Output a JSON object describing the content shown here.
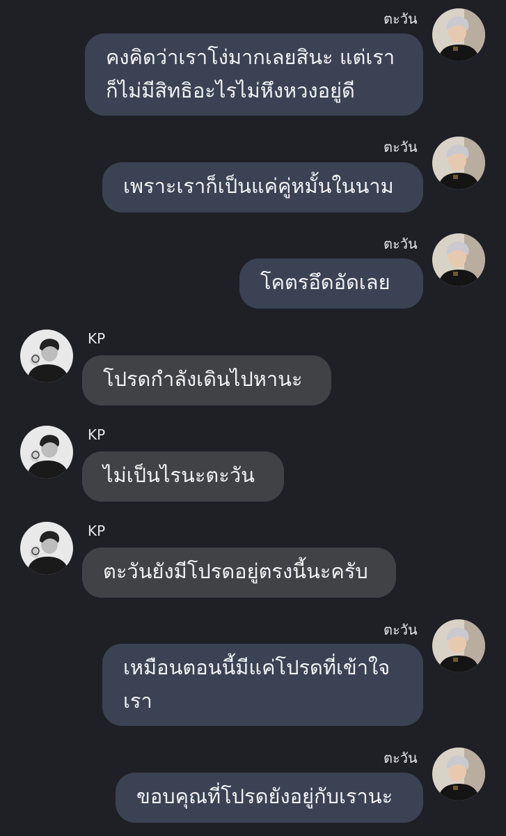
{
  "messages": [
    {
      "side": "me",
      "sender": "ตะวัน",
      "text": "คงคิดว่าเราโง่มากเลยสินะ แต่เรา\nก็ไม่มีสิทธิอะไรไม่หึงหวงอยู่ดี"
    },
    {
      "side": "me",
      "sender": "ตะวัน",
      "text": "เพราะเราก็เป็นแค่คู่หมั้นในนาม"
    },
    {
      "side": "me",
      "sender": "ตะวัน",
      "text": "โคตรอึดอัดเลย"
    },
    {
      "side": "other",
      "sender": "KP",
      "text": "โปรดกำลังเดินไปหานะ"
    },
    {
      "side": "other",
      "sender": "KP",
      "text": "ไม่เป็นไรนะตะวัน"
    },
    {
      "side": "other",
      "sender": "KP",
      "text": "ตะวันยังมีโปรดอยู่ตรงนี้นะครับ"
    },
    {
      "side": "me",
      "sender": "ตะวัน",
      "text": "เหมือนตอนนี้มีแค่โปรดที่เข้าใจ\nเรา"
    },
    {
      "side": "me",
      "sender": "ตะวัน",
      "text": "ขอบคุณที่โปรดยังอยู่กับเรานะ"
    }
  ],
  "colors": {
    "background": "#1f2026",
    "my_bubble": "#3a4254",
    "other_bubble": "#414246",
    "text": "#f2f2f4"
  },
  "icons": {
    "my_avatar": "avatar-photo-light-hair",
    "other_avatar": "avatar-photo-monochrome"
  }
}
